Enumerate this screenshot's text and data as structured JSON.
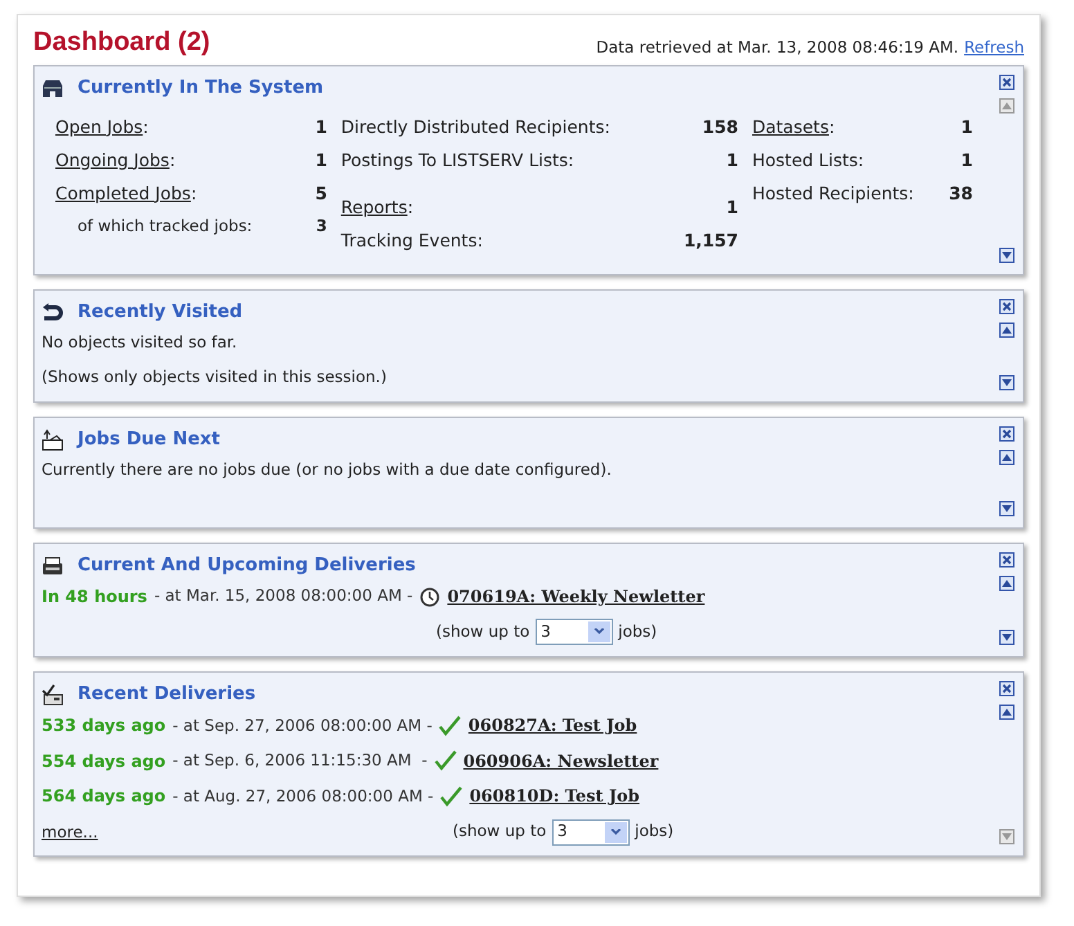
{
  "header": {
    "title": "Dashboard (2)",
    "retrieved": "Data retrieved at Mar. 13, 2008 08:46:19 AM.",
    "refresh": "Refresh"
  },
  "panels": [
    {
      "kind": "stats",
      "title": "Currently In The System",
      "move_up": {
        "disabled": true
      },
      "move_down": {
        "disabled": false
      },
      "columns": [
        [
          [
            {
              "link": "Open Jobs",
              "label": ":",
              "sub": false,
              "value": "1"
            },
            {
              "link": "Ongoing Jobs",
              "label": ":",
              "sub": false,
              "value": "1"
            },
            {
              "link": "Completed Jobs",
              "label": ":",
              "sub": false,
              "value": "5"
            },
            {
              "label": "of which tracked jobs:",
              "sub": true,
              "value": "3"
            }
          ]
        ],
        [
          [
            {
              "label": "Directly Distributed Recipients:",
              "sub": false,
              "value": "158"
            },
            {
              "label": "Postings To LISTSERV Lists:",
              "sub": false,
              "value": "1"
            }
          ],
          [
            {
              "link": "Reports",
              "label": ":",
              "sub": false,
              "value": "1"
            },
            {
              "label": "Tracking Events:",
              "sub": false,
              "value": "1,157"
            }
          ]
        ],
        [
          [
            {
              "link": "Datasets",
              "label": ":",
              "sub": false,
              "value": "1"
            },
            {
              "label": "Hosted Lists:",
              "sub": false,
              "value": "1"
            },
            {
              "label": "Hosted Recipients:",
              "sub": false,
              "value": "38"
            }
          ]
        ]
      ]
    },
    {
      "kind": "text",
      "title": "Recently Visited",
      "move_up": {
        "disabled": false
      },
      "move_down": {
        "disabled": false
      },
      "lines": [
        "No objects visited so far.",
        "(Shows only objects visited in this session.)"
      ]
    },
    {
      "kind": "text",
      "title": "Jobs Due Next",
      "move_up": {
        "disabled": false
      },
      "move_down": {
        "disabled": false
      },
      "lines": [
        "Currently there are no jobs due (or no jobs with a due date configured)."
      ]
    },
    {
      "kind": "deliveries",
      "title": "Current And Upcoming Deliveries",
      "move_up": {
        "disabled": false
      },
      "move_down": {
        "disabled": false
      },
      "rows": [
        {
          "when": "In 48 hours",
          "at": "- at Mar. 15, 2008 08:00:00 AM -",
          "kind": "scheduled",
          "job": "070619A: Weekly Newletter"
        }
      ],
      "limit": {
        "prefix": "(show up to",
        "value": "3",
        "suffix": "jobs)"
      }
    },
    {
      "kind": "deliveries",
      "title": "Recent Deliveries",
      "move_up": {
        "disabled": false
      },
      "move_down": {
        "disabled": true
      },
      "rows": [
        {
          "when": "533 days ago",
          "at": "- at Sep. 27, 2006 08:00:00 AM -",
          "kind": "done",
          "job": "060827A: Test Job"
        },
        {
          "when": "554 days ago",
          "at": "- at Sep. 6, 2006 11:15:30 AM  -",
          "kind": "done",
          "job": "060906A: Newsletter"
        },
        {
          "when": "564 days ago",
          "at": "- at Aug. 27, 2006 08:00:00 AM -",
          "kind": "done",
          "job": "060810D: Test Job"
        }
      ],
      "more": "more...",
      "limit": {
        "prefix": "(show up to",
        "value": "3",
        "suffix": "jobs)"
      }
    }
  ]
}
